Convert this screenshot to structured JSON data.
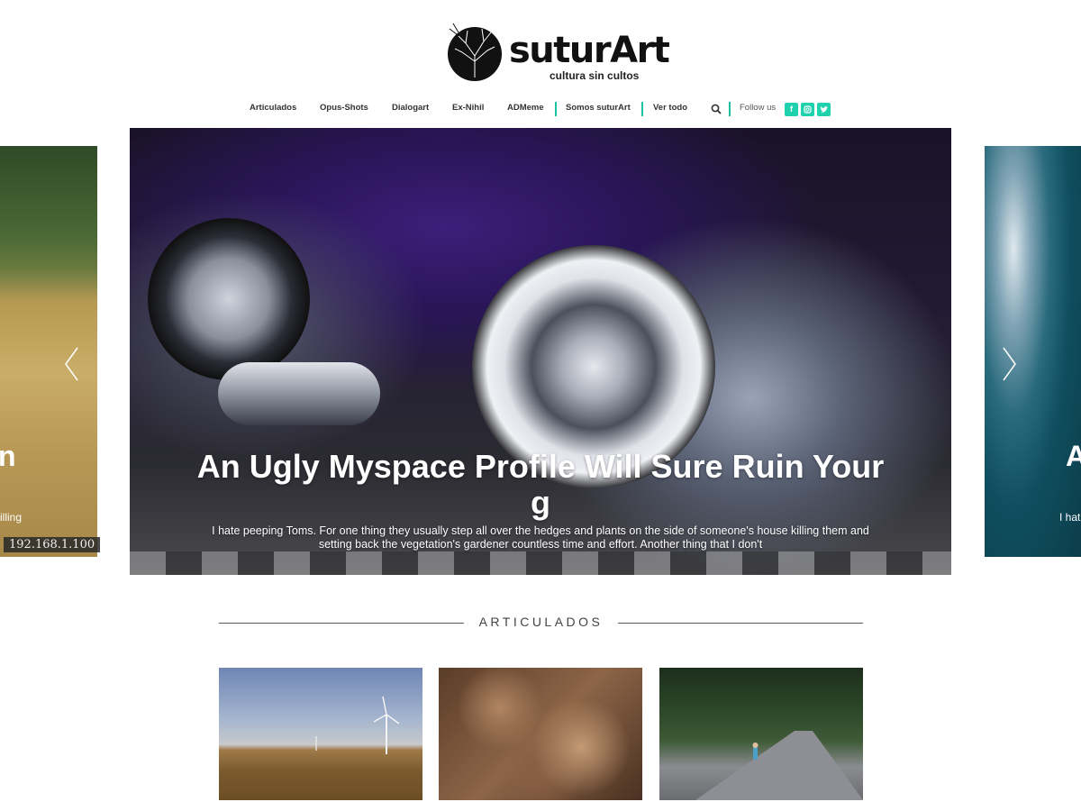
{
  "brand": {
    "name": "suturArt",
    "tagline": "cultura sin cultos"
  },
  "nav": {
    "items": [
      "Articulados",
      "Opus-Shots",
      "Dialogart",
      "Ex-Nihil",
      "ADMeme",
      "Somos suturArt",
      "Ver todo"
    ],
    "follow_label": "Follow us",
    "social": [
      "facebook-icon",
      "instagram-icon",
      "twitter-icon"
    ],
    "accent": "#1fd1ad"
  },
  "slider": {
    "left_partial_title": "n",
    "left_partial_excerpt": "illing",
    "ip_overlay": "192.168.1.100",
    "main_title": "An Ugly Myspace Profile Will Sure Ruin Your g",
    "main_excerpt": "I hate peeping Toms. For one thing they usually step all over the hedges and plants on the side of someone's house killing them and setting back the vegetation's gardener countless time and effort. Another thing that I don't",
    "right_partial_title": "A",
    "right_partial_excerpt": "I hat"
  },
  "section": {
    "title": "ARTICULADOS"
  }
}
